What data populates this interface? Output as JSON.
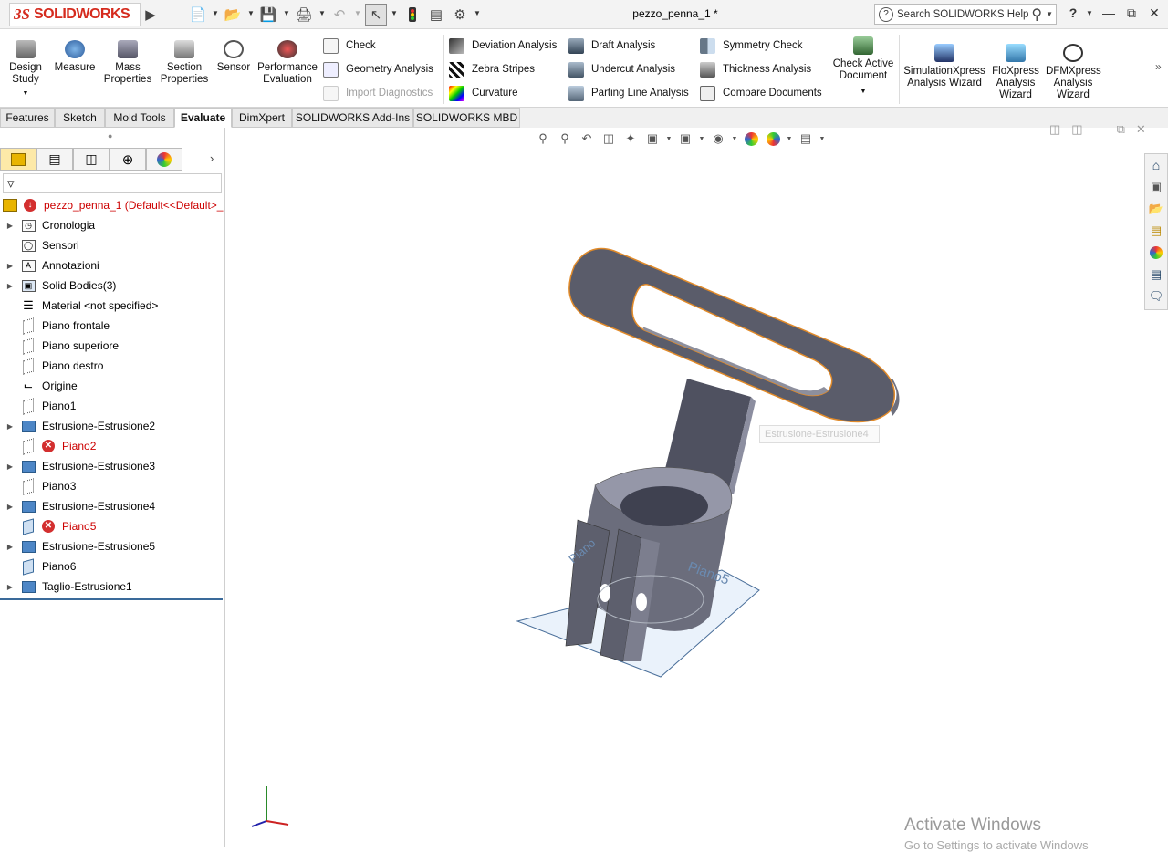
{
  "app": {
    "logo_ds": "3S",
    "logo_name": "SOLIDWORKS",
    "document_title": "pezzo_penna_1 *",
    "search_placeholder": "Search SOLIDWORKS Help",
    "help": "?"
  },
  "command_manager": {
    "big_buttons": [
      {
        "label": "Design Study",
        "icon": "design-study-icon"
      },
      {
        "label": "Measure",
        "icon": "measure-icon"
      },
      {
        "label": "Mass Properties",
        "icon": "mass-properties-icon"
      },
      {
        "label": "Section Properties",
        "icon": "section-properties-icon"
      },
      {
        "label": "Sensor",
        "icon": "sensor-icon"
      },
      {
        "label": "Performance Evaluation",
        "icon": "performance-evaluation-icon"
      }
    ],
    "col1": [
      "Check",
      "Geometry Analysis",
      "Import Diagnostics"
    ],
    "col2": [
      "Deviation Analysis",
      "Zebra Stripes",
      "Curvature"
    ],
    "col3": [
      "Draft Analysis",
      "Undercut Analysis",
      "Parting Line Analysis"
    ],
    "col4": [
      "Symmetry Check",
      "Thickness Analysis",
      "Compare Documents"
    ],
    "check_active": "Check Active Document",
    "wizards": [
      "SimulationXpress Analysis Wizard",
      "FloXpress Analysis Wizard",
      "DFMXpress Analysis Wizard"
    ]
  },
  "tabs": [
    "Features",
    "Sketch",
    "Mold Tools",
    "Evaluate",
    "DimXpert",
    "SOLIDWORKS Add-Ins",
    "SOLIDWORKS MBD"
  ],
  "active_tab": "Evaluate",
  "tree": {
    "root": "pezzo_penna_1  (Default<<Default>_",
    "items": [
      {
        "label": "Cronologia",
        "expand": true
      },
      {
        "label": "Sensori",
        "expand": false
      },
      {
        "label": "Annotazioni",
        "expand": true
      },
      {
        "label": "Solid Bodies(3)",
        "expand": true
      },
      {
        "label": "Material <not specified>",
        "expand": false
      },
      {
        "label": "Piano frontale",
        "expand": false
      },
      {
        "label": "Piano superiore",
        "expand": false
      },
      {
        "label": "Piano destro",
        "expand": false
      },
      {
        "label": "Origine",
        "expand": false
      },
      {
        "label": "Piano1",
        "expand": false
      },
      {
        "label": "Estrusione-Estrusione2",
        "expand": true
      },
      {
        "label": "Piano2",
        "expand": false,
        "error": true
      },
      {
        "label": "Estrusione-Estrusione3",
        "expand": true
      },
      {
        "label": "Piano3",
        "expand": false
      },
      {
        "label": "Estrusione-Estrusione4",
        "expand": true
      },
      {
        "label": "Piano5",
        "expand": false,
        "error": true
      },
      {
        "label": "Estrusione-Estrusione5",
        "expand": true
      },
      {
        "label": "Piano6",
        "expand": false
      },
      {
        "label": "Taglio-Estrusione1",
        "expand": true
      }
    ]
  },
  "viewport": {
    "tooltip": "Estrusione-Estrusione4",
    "plane_label_1": "Piano5",
    "plane_label_2": "Piano",
    "activate_title": "Activate Windows",
    "activate_sub": "Go to Settings to activate Windows"
  },
  "colors": {
    "brand": "#d52b1e",
    "tree_error": "#cc0000",
    "model": "#5c5e6e",
    "edge": "#e08a2a"
  }
}
